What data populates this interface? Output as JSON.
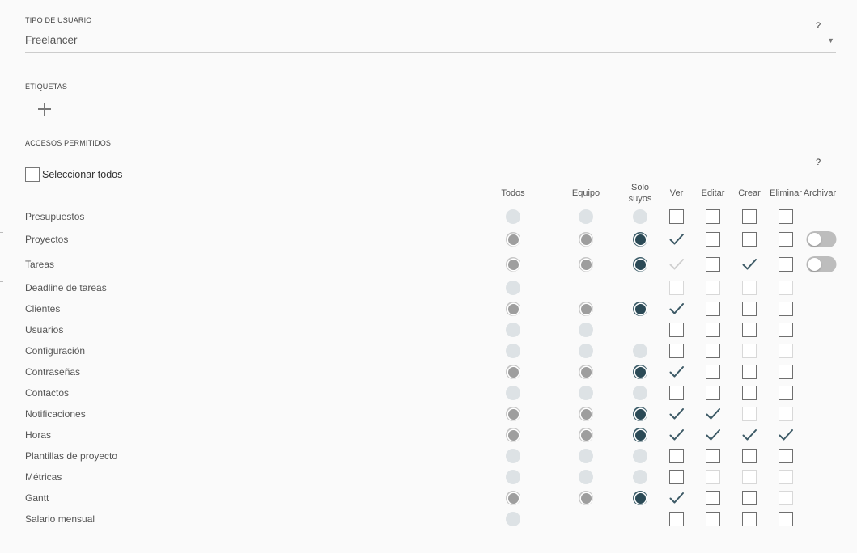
{
  "user_type": {
    "label": "TIPO DE USUARIO",
    "help": "?",
    "value": "Freelancer",
    "arrow": "▼"
  },
  "tags": {
    "label": "ETIQUETAS",
    "add_icon": "plus-icon"
  },
  "access": {
    "label": "ACCESOS PERMITIDOS",
    "help": "?",
    "select_all_label": "Seleccionar todos",
    "columns": {
      "todos": "Todos",
      "equipo": "Equipo",
      "solo": "Solo\nsuyos",
      "ver": "Ver",
      "editar": "Editar",
      "crear": "Crear",
      "eliminar": "Eliminar",
      "archivar": "Archivar"
    },
    "rows": [
      {
        "label": "Presupuestos",
        "todos": "off",
        "equipo": "off",
        "solo": "off",
        "ver": "unchecked",
        "editar": "unchecked",
        "crear": "unchecked",
        "eliminar": "unchecked",
        "archivar": "none"
      },
      {
        "label": "Proyectos",
        "todos": "gray",
        "equipo": "gray",
        "solo": "dark",
        "ver": "checked",
        "editar": "unchecked",
        "crear": "unchecked",
        "eliminar": "unchecked",
        "archivar": "toggle-off"
      },
      {
        "label": "Tareas",
        "todos": "gray",
        "equipo": "gray",
        "solo": "dark",
        "ver": "checked-disabled",
        "editar": "unchecked",
        "crear": "checked",
        "eliminar": "unchecked",
        "archivar": "toggle-off"
      },
      {
        "label": "Deadline de tareas",
        "todos": "off",
        "equipo": "none",
        "solo": "none",
        "ver": "disabled",
        "editar": "disabled",
        "crear": "disabled",
        "eliminar": "disabled",
        "archivar": "none"
      },
      {
        "label": "Clientes",
        "todos": "gray",
        "equipo": "gray",
        "solo": "dark",
        "ver": "checked",
        "editar": "unchecked",
        "crear": "unchecked",
        "eliminar": "unchecked",
        "archivar": "none"
      },
      {
        "label": "Usuarios",
        "todos": "off",
        "equipo": "off",
        "solo": "none",
        "ver": "unchecked",
        "editar": "unchecked",
        "crear": "unchecked",
        "eliminar": "unchecked",
        "archivar": "none"
      },
      {
        "label": "Configuración",
        "todos": "off",
        "equipo": "off",
        "solo": "off",
        "ver": "unchecked",
        "editar": "unchecked",
        "crear": "disabled",
        "eliminar": "disabled",
        "archivar": "none"
      },
      {
        "label": "Contraseñas",
        "todos": "gray",
        "equipo": "gray",
        "solo": "dark",
        "ver": "checked",
        "editar": "unchecked",
        "crear": "unchecked",
        "eliminar": "unchecked",
        "archivar": "none"
      },
      {
        "label": "Contactos",
        "todos": "off",
        "equipo": "off",
        "solo": "off",
        "ver": "unchecked",
        "editar": "unchecked",
        "crear": "unchecked",
        "eliminar": "unchecked",
        "archivar": "none"
      },
      {
        "label": "Notificaciones",
        "todos": "gray",
        "equipo": "gray",
        "solo": "dark",
        "ver": "checked",
        "editar": "checked",
        "crear": "disabled",
        "eliminar": "disabled",
        "archivar": "none"
      },
      {
        "label": "Horas",
        "todos": "gray",
        "equipo": "gray",
        "solo": "dark",
        "ver": "checked",
        "editar": "checked",
        "crear": "checked",
        "eliminar": "checked",
        "archivar": "none"
      },
      {
        "label": "Plantillas de proyecto",
        "todos": "off",
        "equipo": "off",
        "solo": "off",
        "ver": "unchecked",
        "editar": "unchecked",
        "crear": "unchecked",
        "eliminar": "unchecked",
        "archivar": "none"
      },
      {
        "label": "Métricas",
        "todos": "off",
        "equipo": "off",
        "solo": "off",
        "ver": "unchecked",
        "editar": "disabled",
        "crear": "disabled",
        "eliminar": "disabled",
        "archivar": "none"
      },
      {
        "label": "Gantt",
        "todos": "gray",
        "equipo": "gray",
        "solo": "dark",
        "ver": "checked",
        "editar": "unchecked",
        "crear": "unchecked",
        "eliminar": "disabled",
        "archivar": "none"
      },
      {
        "label": "Salario mensual",
        "todos": "off",
        "equipo": "none",
        "solo": "none",
        "ver": "unchecked",
        "editar": "unchecked",
        "crear": "unchecked",
        "eliminar": "unchecked",
        "archivar": "none"
      }
    ]
  },
  "colors": {
    "check_dark": "#3d5a66",
    "check_disabled": "#cfcfcf"
  }
}
